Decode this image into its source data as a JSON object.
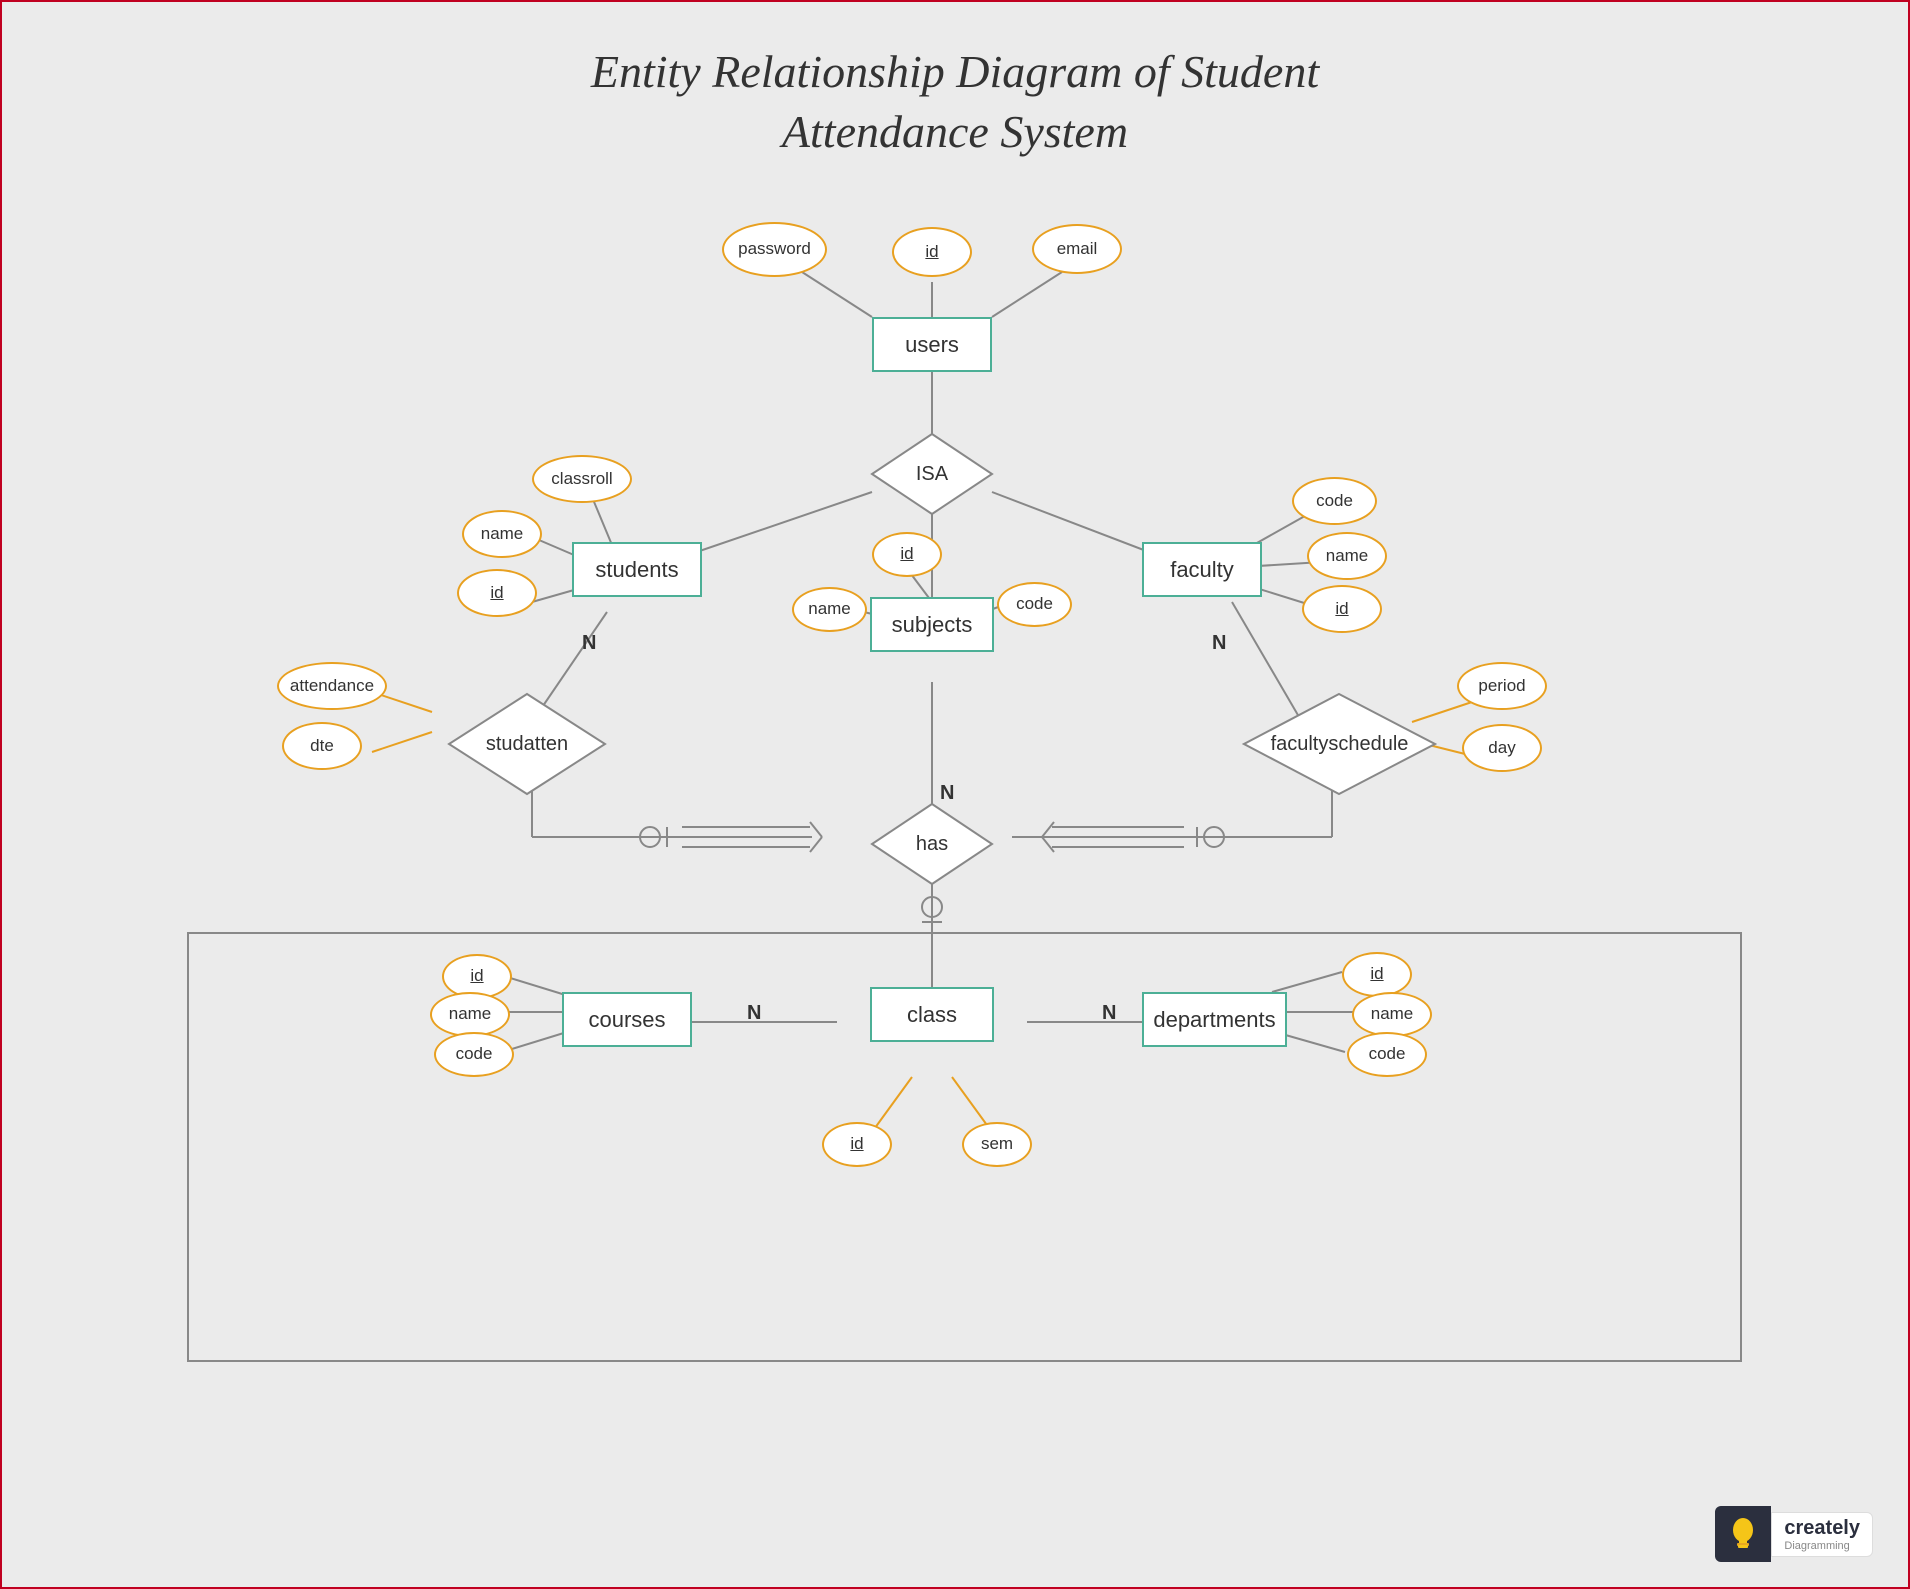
{
  "title": {
    "line1": "Entity Relationship Diagram of Student",
    "line2": "Attendance System"
  },
  "entities": {
    "users": "users",
    "students": "students",
    "faculty": "faculty",
    "subjects": "subjects",
    "courses": "courses",
    "departments": "departments",
    "class": "class"
  },
  "relationships": {
    "isa": "ISA",
    "studatten": "studatten",
    "facultyschedule": "facultyschedule",
    "has": "has"
  },
  "attributes": {
    "users_id": "id",
    "users_password": "password",
    "users_email": "email",
    "students_name": "name",
    "students_classroll": "classroll",
    "students_id": "id",
    "faculty_code": "code",
    "faculty_name": "name",
    "faculty_id": "id",
    "subjects_id": "id",
    "subjects_name": "name",
    "subjects_code": "code",
    "studatten_attendance": "attendance",
    "studatten_dte": "dte",
    "facultyschedule_period": "period",
    "facultyschedule_day": "day",
    "courses_id": "id",
    "courses_name": "name",
    "courses_code": "code",
    "departments_id": "id",
    "departments_name": "name",
    "departments_code": "code",
    "class_id": "id",
    "class_sem": "sem"
  },
  "logo": {
    "name": "creately",
    "sub": "Diagramming"
  }
}
